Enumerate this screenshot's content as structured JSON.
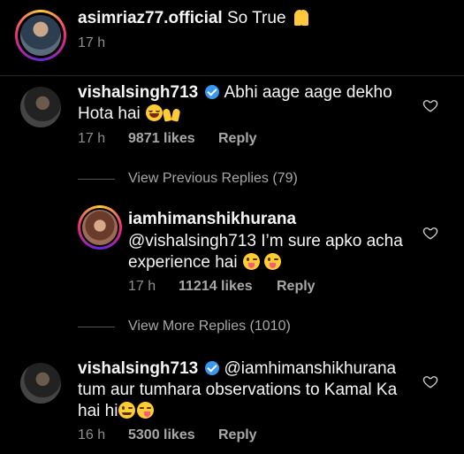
{
  "top_comment": {
    "username": "asimriaz77.official",
    "text": " So True",
    "time": "17 h"
  },
  "comment1": {
    "username": "vishalsingh713",
    "text_line1": "Abhi aage aage dekho",
    "text_line2": "Hota hai ",
    "time": "17 h",
    "likes": "9871 likes",
    "reply": "Reply"
  },
  "view_previous": "View Previous Replies (79)",
  "reply1": {
    "username": "iamhimanshikhurana",
    "text_line1": "@vishalsingh713 I’m sure apko acha",
    "text_line2": "experience hai ",
    "time": "17 h",
    "likes": "11214 likes",
    "reply": "Reply"
  },
  "view_more": "View More Replies (1010)",
  "reply2": {
    "username": "vishalsingh713",
    "mention": "@iamhimanshikhurana",
    "text_line2": "tum aur tumhara observations to Kamal Ka",
    "text_line3": "hai hi",
    "time": "16 h",
    "likes": "5300 likes",
    "reply": "Reply"
  },
  "colors": {
    "background": "#000000",
    "verified": "#3897f0",
    "secondary": "#8e8e8e"
  },
  "icons": [
    "verified-badge-icon",
    "heart-outline-icon",
    "pray-emoji",
    "laughing-emoji",
    "raised-hands-emoji",
    "tongue-emoji",
    "wink-emoji",
    "yum-emoji"
  ]
}
